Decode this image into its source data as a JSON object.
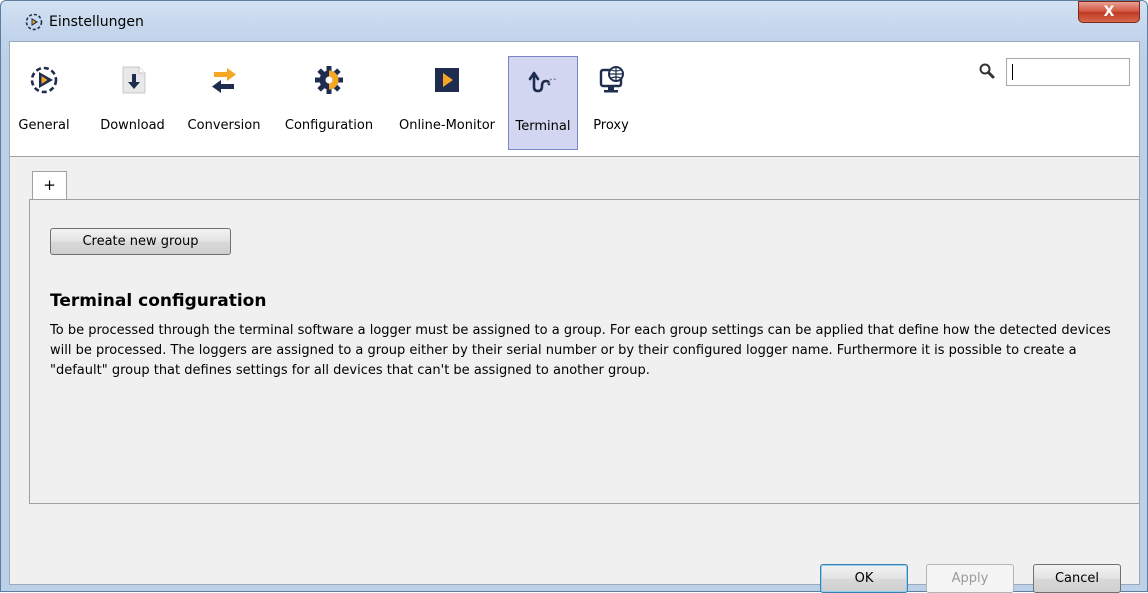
{
  "window": {
    "title": "Einstellungen",
    "close_label": "X"
  },
  "toolbar": {
    "items": [
      {
        "label": "General",
        "icon": "general-icon",
        "selected": false
      },
      {
        "label": "Download",
        "icon": "download-icon",
        "selected": false
      },
      {
        "label": "Conversion",
        "icon": "conversion-icon",
        "selected": false
      },
      {
        "label": "Configuration",
        "icon": "configuration-icon",
        "selected": false
      },
      {
        "label": "Online-Monitor",
        "icon": "online-monitor-icon",
        "selected": false
      },
      {
        "label": "Terminal",
        "icon": "terminal-icon",
        "selected": true
      },
      {
        "label": "Proxy",
        "icon": "proxy-icon",
        "selected": false
      }
    ]
  },
  "search": {
    "value": "",
    "icon": "search-icon"
  },
  "tabs": [
    {
      "label": "+"
    }
  ],
  "panel": {
    "create_button": "Create new group",
    "heading": "Terminal configuration",
    "description": "To be processed through the terminal software a logger must be assigned to a group. For each group settings can be applied that define how the detected devices will be processed. The loggers are assigned to a group either by their serial number or by their configured logger name. Furthermore it is possible to create a \"default\" group that defines settings for all devices that can't be assigned to another group."
  },
  "buttons": {
    "ok": "OK",
    "apply": "Apply",
    "cancel": "Cancel"
  },
  "colors": {
    "accent_orange": "#f5a623",
    "icon_navy": "#1e2d4f",
    "selected_bg": "#d3d6f0"
  }
}
